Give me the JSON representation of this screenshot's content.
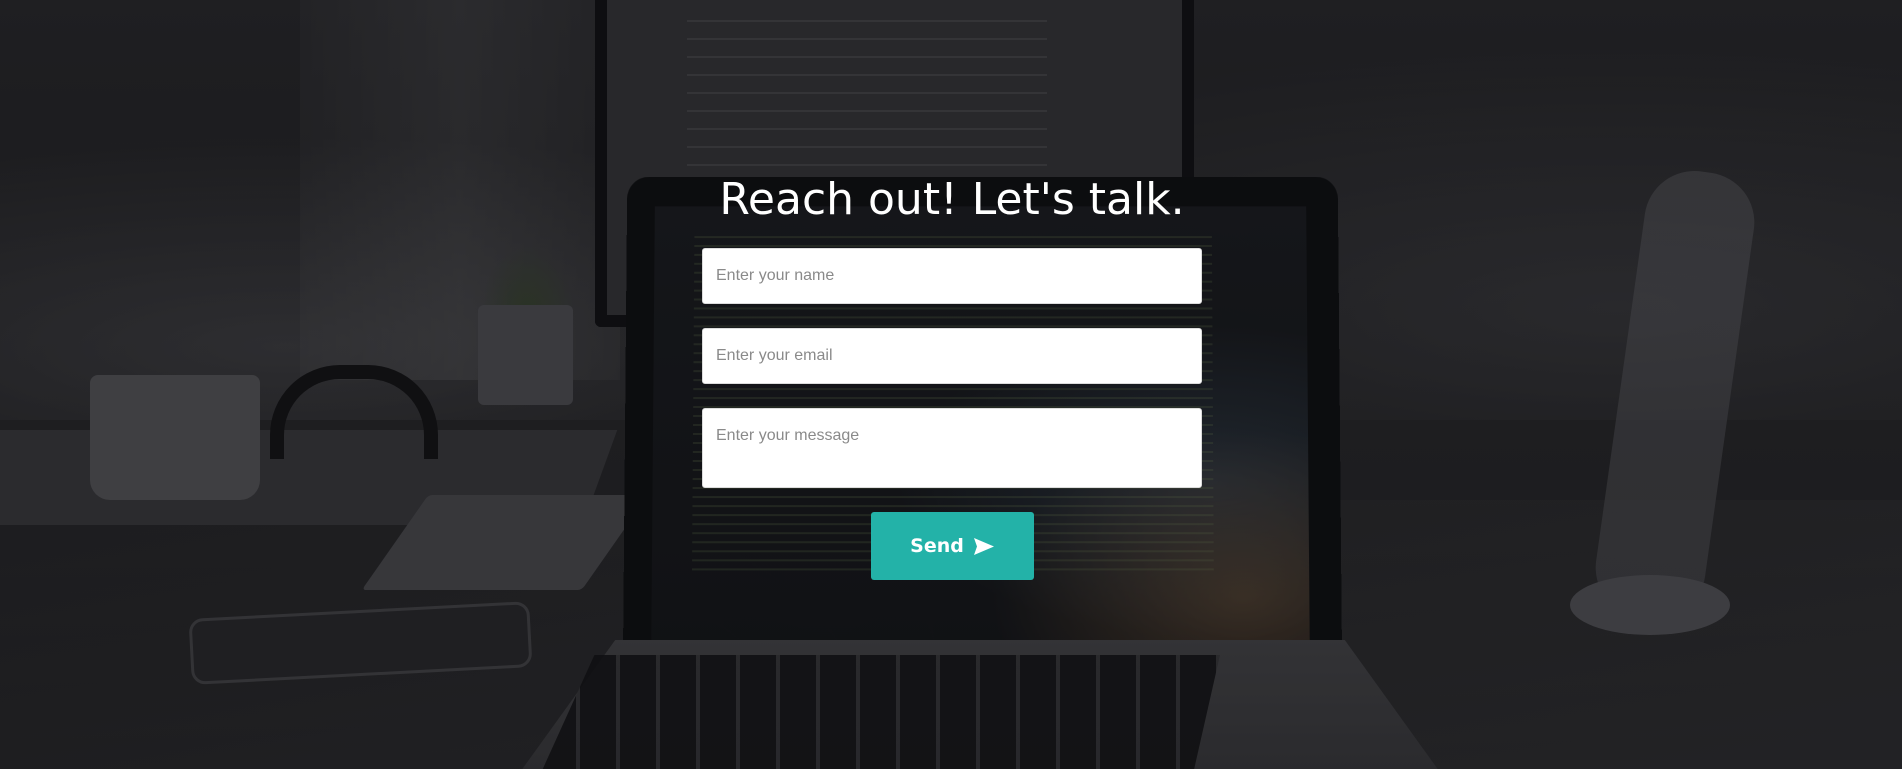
{
  "contact": {
    "title": "Reach out! Let's talk.",
    "name_placeholder": "Enter your name",
    "email_placeholder": "Enter your email",
    "message_placeholder": "Enter your message",
    "send_label": "Send",
    "send_icon": "send-arrow-icon"
  },
  "colors": {
    "accent": "#23b2a8",
    "title_text": "#ffffff",
    "field_bg": "#ffffff",
    "placeholder": "#8a8a8a"
  }
}
